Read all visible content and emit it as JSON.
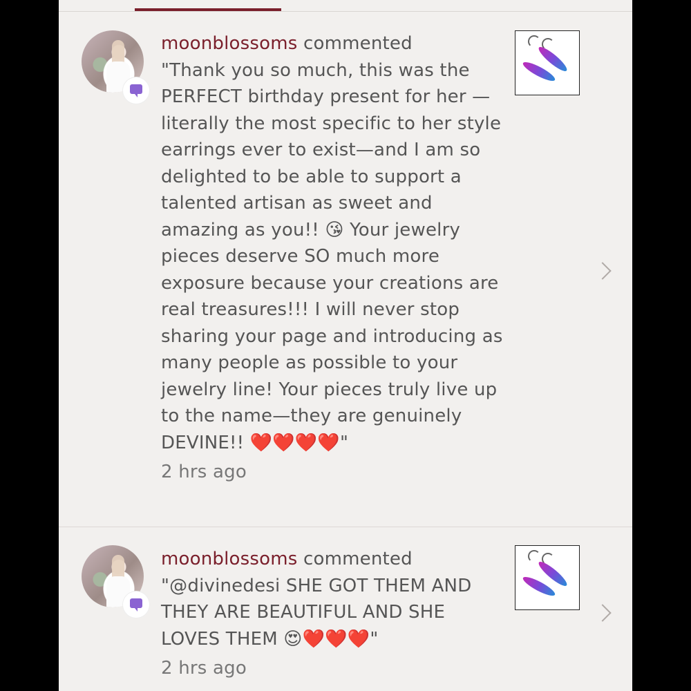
{
  "comments": [
    {
      "username": "moonblossoms",
      "verb": " commented",
      "body": "\"Thank you so much, this was the PERFECT birthday present for her —literally the most specific to her style earrings ever to exist—and I am so delighted to be able to support a talented artisan as sweet and amazing as you!! 😘 Your jewelry pieces deserve SO much more exposure because your creations are real treasures!!! I will never stop sharing your page and introducing as many people as possible to your jewelry line! Your pieces truly live up to the name—they are genuinely DEVINE!! ❤️❤️❤️❤️\"",
      "time": "2 hrs ago"
    },
    {
      "username": "moonblossoms",
      "verb": " commented",
      "body": "\"@divinedesi SHE GOT THEM AND THEY ARE BEAUTIFUL AND SHE LOVES THEM 😍❤️❤️❤️\"",
      "time": "2 hrs ago"
    }
  ],
  "colors": {
    "username": "#7a1f2b",
    "text": "#555555",
    "background": "#f2f0ee",
    "badge": "#8a63d2"
  },
  "icons": {
    "badge": "comment-bubble-icon",
    "chevron": "chevron-right-icon"
  }
}
